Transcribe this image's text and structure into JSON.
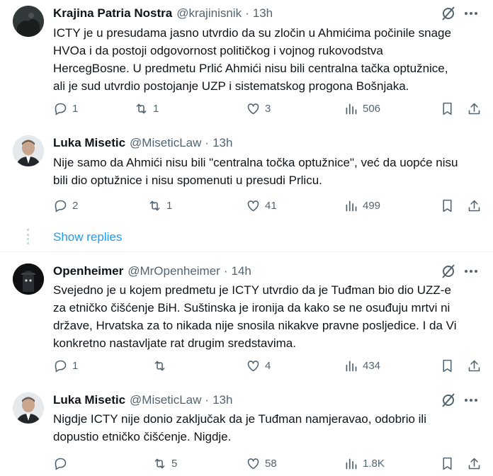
{
  "tweets": [
    {
      "name": "Krajina Patria Nostra",
      "handle": "@krajinisnik",
      "time": "13h",
      "lines": [
        "ICTY je u presudama jasno utvrdio da su zločin u Ahmićima počinile snage",
        "HVOa i da postoji odgovornost političkog i vojnog rukovodstva",
        "HercegBosne. U predmetu Prlić Ahmići nisu bili centralna tačka optužnice,",
        "ali je sud utvrdio postojanje UZP i sistematskog progona Bošnjaka."
      ],
      "replies": "1",
      "reposts": "1",
      "likes": "3",
      "views": "506"
    },
    {
      "name": "Luka Misetic",
      "handle": "@MiseticLaw",
      "time": "13h",
      "lines": [
        "Nije samo da Ahmići nisu bili \"centralna točka optužnice\", već da uopće nisu",
        "bili dio optužnice i nisu spomenuti u presudi Prlicu."
      ],
      "replies": "2",
      "reposts": "1",
      "likes": "41",
      "views": "499"
    },
    {
      "name": "Openheimer",
      "handle": "@MrOpenheimer",
      "time": "14h",
      "lines": [
        "Svejedno je u kojem predmetu je ICTY utvrdio da je Tuđman bio dio UZZ-e",
        "za etničko čišćenje BiH. Suštinska je ironija da kako se ne osuđuju mrtvi ni",
        "države, Hrvatska za to nikada nije snosila nikakve pravne posljedice. I da Vi",
        "konkretno nastavljate rat drugim sredstavima."
      ],
      "replies": "1",
      "reposts": "",
      "likes": "4",
      "views": "434"
    },
    {
      "name": "Luka Misetic",
      "handle": "@MiseticLaw",
      "time": "13h",
      "lines": [
        "Nigdje ICTY nije donio zaključak da je Tuđman namjeravao, odobrio ili",
        "dopustio etničko čišćenje. Nigdje."
      ],
      "replies": "",
      "reposts": "5",
      "likes": "58",
      "views": "1.8K"
    }
  ],
  "show_replies": "Show replies",
  "colors": {
    "accent": "#1d9bf0",
    "muted": "#536471",
    "text": "#0f1419"
  }
}
